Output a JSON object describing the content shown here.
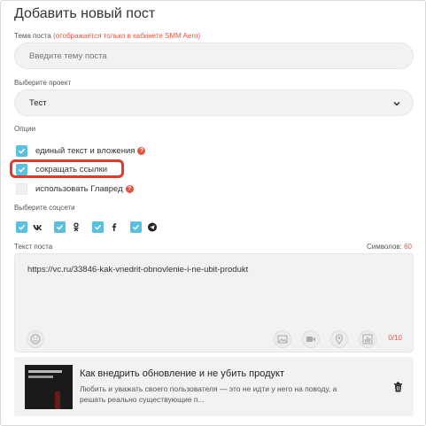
{
  "header": {
    "title": "Добавить новый пост"
  },
  "topic": {
    "label": "Тема поста",
    "note": "(отображается только в кабинете SMM Aero)",
    "placeholder": "Введите тему поста"
  },
  "project": {
    "label": "Выберите проект",
    "selected": "Тест",
    "chevron_icon": "chevron-down-icon"
  },
  "options": {
    "label": "Опции",
    "items": [
      {
        "label": "единый текст и вложения",
        "checked": true,
        "help": true
      },
      {
        "label": "сокращать ссылки",
        "checked": true,
        "help": false
      },
      {
        "label": "использовать Главред",
        "checked": false,
        "help": true
      }
    ],
    "help_glyph": "?"
  },
  "socials": {
    "label": "Выберите соцсети",
    "items": [
      {
        "name": "vk-icon",
        "glyph": "vk",
        "checked": true
      },
      {
        "name": "odnoklassniki-icon",
        "glyph": "ok",
        "checked": true
      },
      {
        "name": "facebook-icon",
        "glyph": "f",
        "checked": true
      },
      {
        "name": "telegram-icon",
        "glyph": "tg",
        "checked": true
      }
    ]
  },
  "post_text": {
    "label": "Текст поста",
    "symbols_label": "Символов:",
    "symbols_count": "60",
    "value": "https://vc.ru/33846-kak-vnedrit-obnovlenie-i-ne-ubit-produkt",
    "counter": "0/10",
    "toolbar_icons": [
      "emoji-icon",
      "image-icon",
      "video-icon",
      "location-icon",
      "chart-icon"
    ]
  },
  "link_preview": {
    "title": "Как внедрить обновление и не убить продукт",
    "description": "Любить и уважать своего пользователя — это не идти у него на поводу, а решать реально существующие п...",
    "delete_icon": "trash-icon"
  },
  "colors": {
    "accent": "#5bc0de",
    "warning": "#e8533f",
    "highlight": "#e23b2e",
    "field_bg": "#f2f2f2"
  }
}
